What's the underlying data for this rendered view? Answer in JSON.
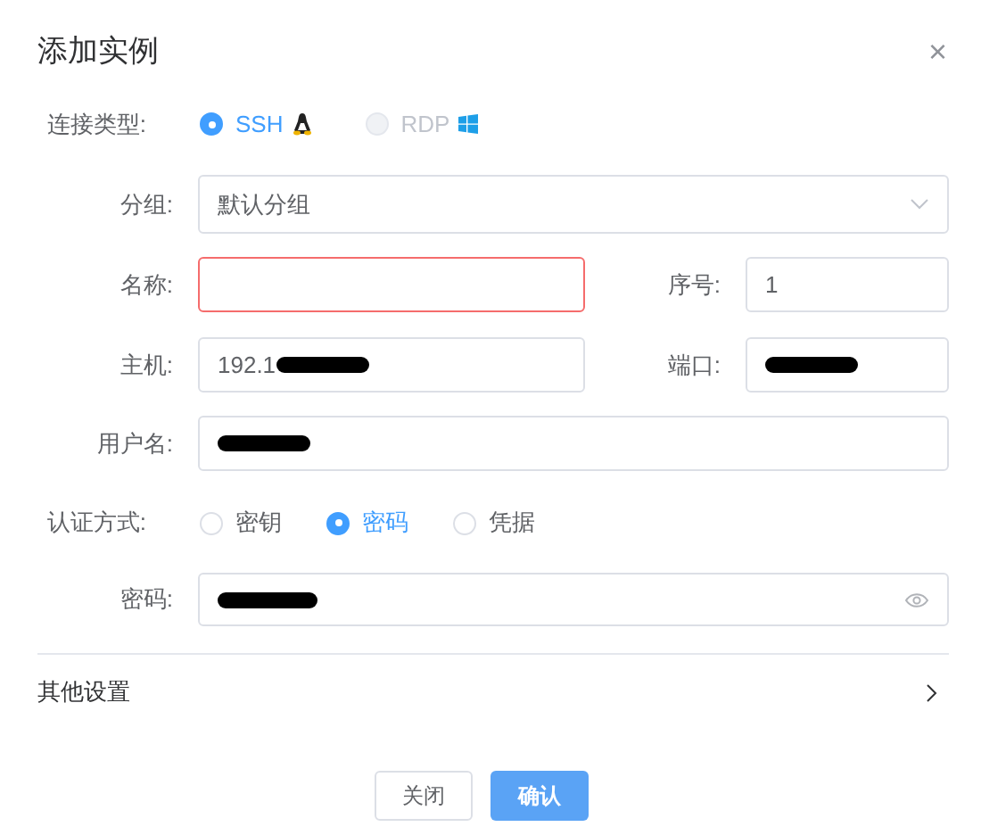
{
  "dialog": {
    "title": "添加实例",
    "close": "×"
  },
  "connection_type": {
    "label": "连接类型:",
    "options": [
      {
        "label": "SSH",
        "kind": "linux",
        "selected": true,
        "disabled": false
      },
      {
        "label": "RDP",
        "kind": "windows",
        "selected": false,
        "disabled": true
      }
    ]
  },
  "group": {
    "label": "分组:",
    "value": "默认分组"
  },
  "name": {
    "label": "名称:",
    "error": true
  },
  "order": {
    "label": "序号:",
    "value": "1"
  },
  "host": {
    "label": "主机:",
    "value": "192.1",
    "redacted": true
  },
  "port": {
    "label": "端口:",
    "redacted": true
  },
  "username": {
    "label": "用户名:",
    "redacted": true
  },
  "auth_method": {
    "label": "认证方式:",
    "options": [
      {
        "label": "密钥",
        "selected": false
      },
      {
        "label": "密码",
        "selected": true
      },
      {
        "label": "凭据",
        "selected": false
      }
    ]
  },
  "password": {
    "label": "密码:",
    "redacted": true
  },
  "other_settings": {
    "label": "其他设置",
    "expanded": false
  },
  "buttons": [
    {
      "label": "关闭",
      "kind": "secondary"
    },
    {
      "label": "确认",
      "kind": "primary"
    }
  ]
}
